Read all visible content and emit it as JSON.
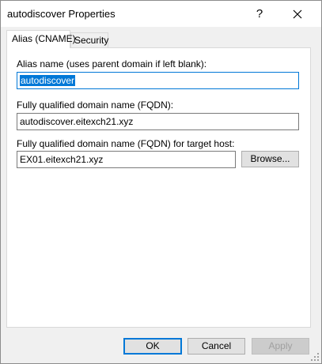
{
  "window": {
    "title": "autodiscover Properties",
    "help_glyph": "?",
    "close_icon": "close-icon"
  },
  "tabs": [
    {
      "label": "Alias (CNAME)",
      "active": true
    },
    {
      "label": "Security",
      "active": false
    }
  ],
  "form": {
    "alias_label": "Alias name (uses parent domain if left blank):",
    "alias_value": "autodiscover",
    "fqdn_label": "Fully qualified domain name (FQDN):",
    "fqdn_value": "autodiscover.eitexch21.xyz",
    "target_label": "Fully qualified domain name (FQDN) for target host:",
    "target_value": "EX01.eitexch21.xyz",
    "browse_label": "Browse..."
  },
  "buttons": {
    "ok": "OK",
    "cancel": "Cancel",
    "apply": "Apply"
  },
  "colors": {
    "accent": "#0078d7",
    "disabled_text": "#a0a0a0"
  }
}
